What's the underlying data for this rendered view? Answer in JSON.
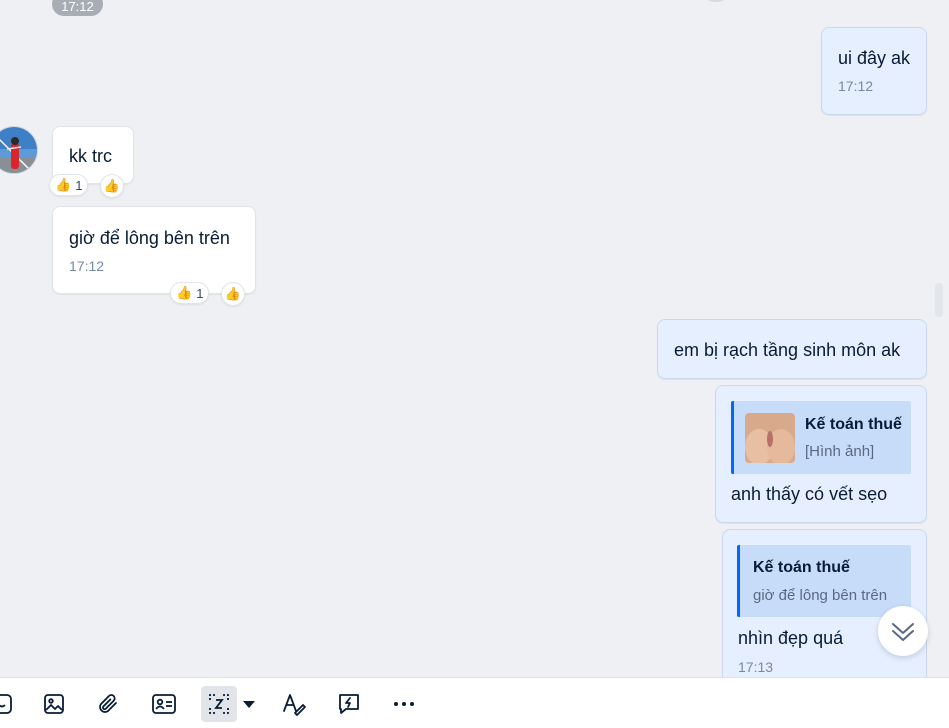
{
  "chat": {
    "top_time_chip": "17:12",
    "messages": [
      {
        "id": "m1",
        "direction": "out",
        "text": "ui đây ak",
        "time": "17:12"
      },
      {
        "id": "m2",
        "direction": "in",
        "text": "kk trc",
        "reaction": {
          "emoji": "👍",
          "count": "1"
        }
      },
      {
        "id": "m3",
        "direction": "in",
        "text": "giờ để lông bên trên",
        "time": "17:12",
        "reaction": {
          "emoji": "👍",
          "count": "1"
        }
      },
      {
        "id": "m4",
        "direction": "out",
        "text": "em bị rạch tầng sinh môn ak"
      },
      {
        "id": "m5",
        "direction": "out",
        "quote": {
          "name": "Kế toán thuế",
          "sub": "[Hình ảnh]"
        },
        "text": "anh thấy có vết sẹo"
      },
      {
        "id": "m6",
        "direction": "out",
        "quote": {
          "name": "Kế toán thuế",
          "sub": "giờ để lông bên trên"
        },
        "text": "nhìn đẹp quá",
        "time": "17:13"
      }
    ],
    "scroll_down_icon": "double-chevron-down-icon"
  },
  "toolbar": {
    "icons": [
      "sticker-icon",
      "image-icon",
      "attachment-icon",
      "contact-card-icon",
      "screenshot-icon",
      "dropdown-caret-icon",
      "text-format-icon",
      "quick-message-icon",
      "more-icon"
    ],
    "accent": "#0068ff"
  }
}
